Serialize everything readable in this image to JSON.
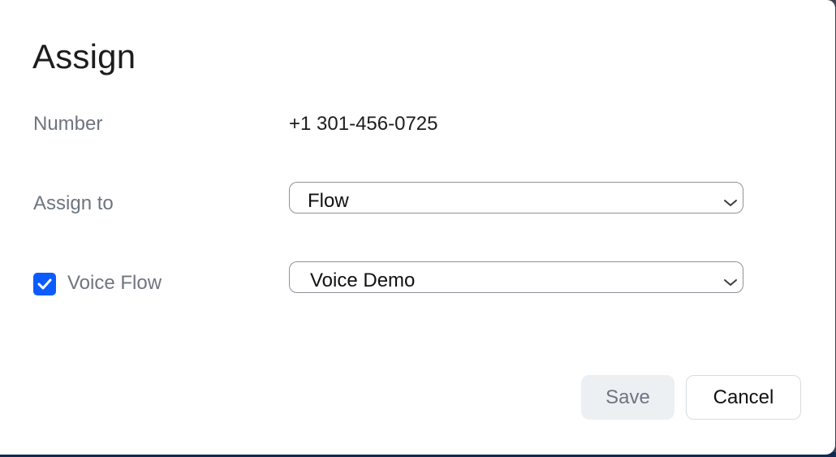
{
  "dialog": {
    "title": "Assign"
  },
  "number": {
    "label": "Number",
    "value": "+1 301-456-0725"
  },
  "assign_to": {
    "label": "Assign to",
    "selected": "Flow"
  },
  "voice_flow": {
    "checked": true,
    "label": "Voice Flow",
    "selected": "Voice Demo"
  },
  "buttons": {
    "save": "Save",
    "cancel": "Cancel"
  },
  "colors": {
    "accent": "#0b5cff",
    "label_gray": "#6e7580",
    "text_dark": "#1d1d1f",
    "disabled_bg": "#edf0f3"
  },
  "icons": {
    "checkbox": "check-icon",
    "dropdown": "chevron-down-icon"
  }
}
